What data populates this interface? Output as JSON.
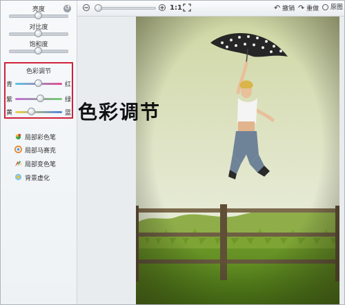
{
  "left_panel": {
    "adjustments": [
      {
        "label": "亮度",
        "value": 0.5
      },
      {
        "label": "对比度",
        "value": 0.5
      },
      {
        "label": "饱和度",
        "value": 0.5
      }
    ],
    "color_balance": {
      "title": "色彩调节",
      "rows": [
        {
          "left": "青",
          "right": "红",
          "value": 0.5,
          "gradient": [
            "#58c6e8",
            "#e64b8f"
          ]
        },
        {
          "left": "紫",
          "right": "绿",
          "value": 0.55,
          "gradient": [
            "#c76ad8",
            "#6fcf6f"
          ]
        },
        {
          "left": "黄",
          "right": "蓝",
          "value": 0.35,
          "gradient": [
            "#f0d247",
            "#4a86e0"
          ]
        }
      ]
    },
    "tools": [
      {
        "label": "局部彩色笔",
        "icon": "color-brush-icon"
      },
      {
        "label": "局部马赛克",
        "icon": "mosaic-icon"
      },
      {
        "label": "局部变色笔",
        "icon": "recolor-brush-icon"
      },
      {
        "label": "背景虚化",
        "icon": "blur-icon"
      }
    ]
  },
  "caption": "色彩调节",
  "toolbar": {
    "zoom_value": 0.05,
    "one_to_one": "1:1",
    "undo": "撤销",
    "redo": "重做",
    "original": "原图"
  },
  "colors": {
    "highlight_border": "#d0213a",
    "panel_bg": "#f1f4f7"
  }
}
